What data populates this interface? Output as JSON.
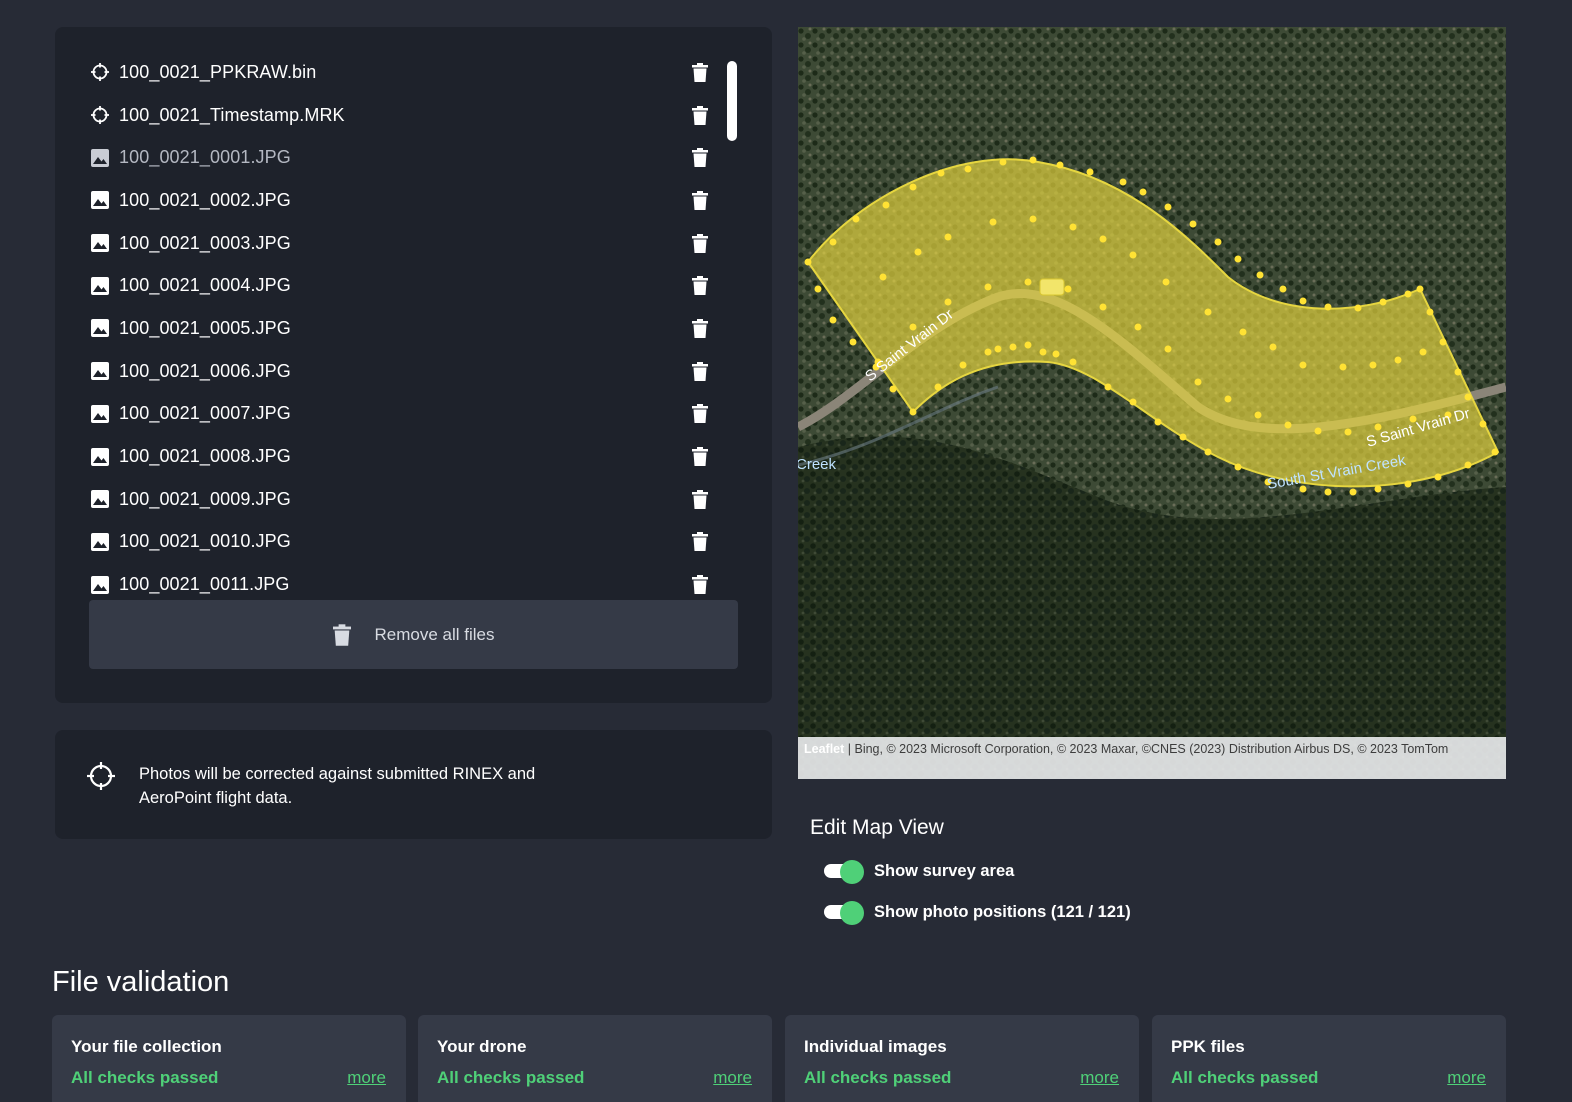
{
  "files": {
    "items": [
      {
        "name": "100_0021_PPKRAW.bin",
        "icon": "crosshair-icon",
        "dim": false
      },
      {
        "name": "100_0021_Timestamp.MRK",
        "icon": "crosshair-icon",
        "dim": false
      },
      {
        "name": "100_0021_0001.JPG",
        "icon": "image-icon",
        "dim": true
      },
      {
        "name": "100_0021_0002.JPG",
        "icon": "image-icon",
        "dim": false
      },
      {
        "name": "100_0021_0003.JPG",
        "icon": "image-icon",
        "dim": false
      },
      {
        "name": "100_0021_0004.JPG",
        "icon": "image-icon",
        "dim": false
      },
      {
        "name": "100_0021_0005.JPG",
        "icon": "image-icon",
        "dim": false
      },
      {
        "name": "100_0021_0006.JPG",
        "icon": "image-icon",
        "dim": false
      },
      {
        "name": "100_0021_0007.JPG",
        "icon": "image-icon",
        "dim": false
      },
      {
        "name": "100_0021_0008.JPG",
        "icon": "image-icon",
        "dim": false
      },
      {
        "name": "100_0021_0009.JPG",
        "icon": "image-icon",
        "dim": false
      },
      {
        "name": "100_0021_0010.JPG",
        "icon": "image-icon",
        "dim": false
      },
      {
        "name": "100_0021_0011.JPG",
        "icon": "image-icon",
        "dim": false
      }
    ],
    "remove_all_label": "Remove all files"
  },
  "info": {
    "text": "Photos will be corrected against submitted RINEX and AeroPoint flight data."
  },
  "map": {
    "attribution_leaflet": "Leaflet",
    "attribution_text": " | Bing, © 2023 Microsoft Corporation, © 2023 Maxar, ©CNES (2023) Distribution Airbus DS, © 2023 TomTom",
    "road_label_1": "S Saint Vrain Dr",
    "road_label_2": "S Saint Vrain Dr",
    "creek_label_1": "South St Vrain Creek",
    "creek_label_2": "Creek",
    "survey_color": "#e6d640"
  },
  "edit_map": {
    "title": "Edit Map View",
    "toggles": [
      {
        "label": "Show survey area",
        "on": true
      },
      {
        "label": "Show photo positions (121 / 121)",
        "on": true
      }
    ]
  },
  "validation": {
    "title": "File validation",
    "cards": [
      {
        "title": "Your file collection",
        "status": "All checks passed",
        "more": "more"
      },
      {
        "title": "Your drone",
        "status": "All checks passed",
        "more": "more"
      },
      {
        "title": "Individual images",
        "status": "All checks passed",
        "more": "more"
      },
      {
        "title": "PPK files",
        "status": "All checks passed",
        "more": "more"
      }
    ]
  },
  "colors": {
    "background": "#272b36",
    "panel": "#1e222b",
    "success": "#4fd078"
  }
}
